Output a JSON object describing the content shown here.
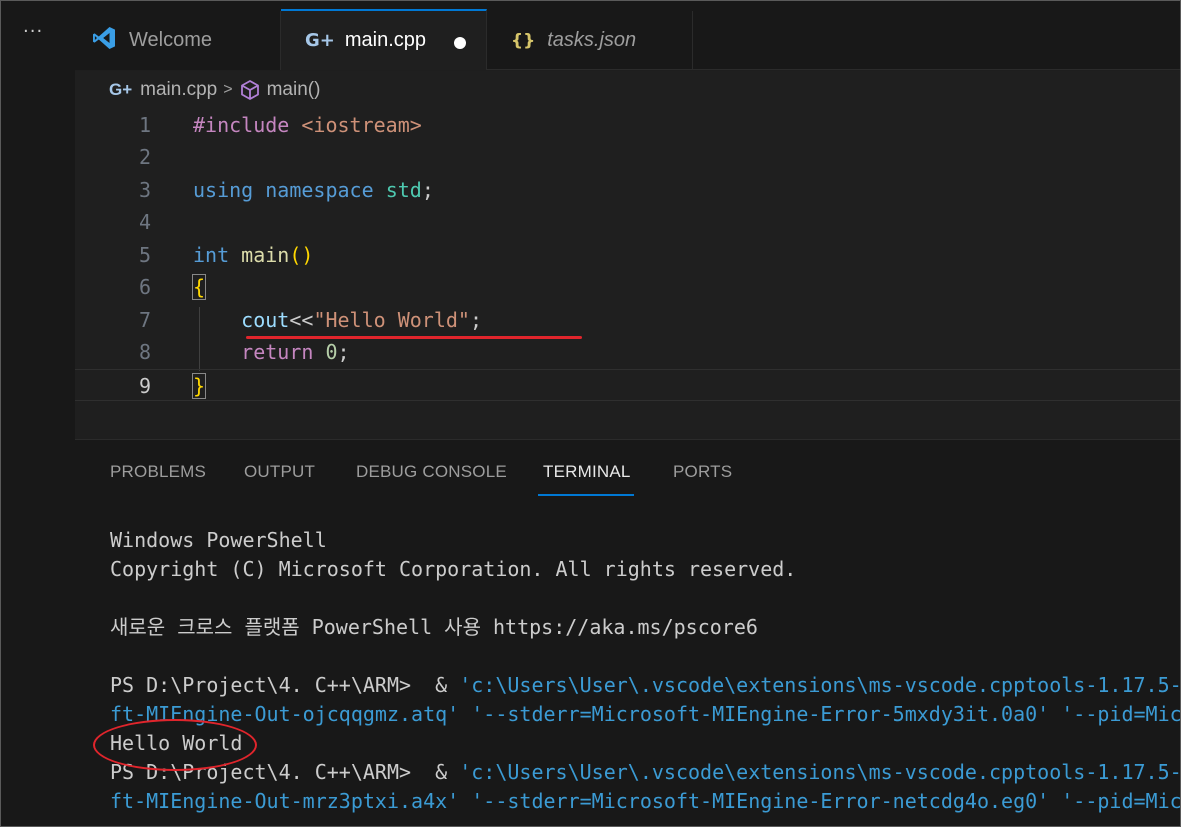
{
  "window": {
    "more_actions_label": "···"
  },
  "tabs": [
    {
      "label": "Welcome",
      "icon": "vscode-logo-icon",
      "active": false
    },
    {
      "label": "main.cpp",
      "icon": "cpp-file-icon",
      "active": true,
      "modified": true
    },
    {
      "label": "tasks.json",
      "icon": "json-file-icon",
      "active": false,
      "preview": true
    }
  ],
  "breadcrumb": {
    "file": "main.cpp",
    "symbol": "main()"
  },
  "editor": {
    "current_line": 9,
    "lines": [
      {
        "num": "1"
      },
      {
        "num": "2"
      },
      {
        "num": "3"
      },
      {
        "num": "4"
      },
      {
        "num": "5"
      },
      {
        "num": "6"
      },
      {
        "num": "7"
      },
      {
        "num": "8"
      },
      {
        "num": "9"
      }
    ],
    "tokens": {
      "l1_pre": "#include",
      "l1_inc": "<iostream>",
      "l3_using": "using",
      "l3_namespace": "namespace",
      "l3_std": "std",
      "l3_semi": ";",
      "l5_int": "int",
      "l5_main": "main",
      "l5_parens": "()",
      "l6_open": "{",
      "l7_cout": "cout",
      "l7_op": "<<",
      "l7_str": "\"Hello World\"",
      "l7_semi": ";",
      "l8_return": "return",
      "l8_zero": "0",
      "l8_semi": ";",
      "l9_close": "}"
    }
  },
  "panel": {
    "tabs": [
      "PROBLEMS",
      "OUTPUT",
      "DEBUG CONSOLE",
      "TERMINAL",
      "PORTS"
    ],
    "active_tab": "TERMINAL"
  },
  "terminal": {
    "l1": "Windows PowerShell",
    "l2": "Copyright (C) Microsoft Corporation. All rights reserved.",
    "l3": "새로운 크로스 플랫폼 PowerShell 사용 https://aka.ms/pscore6",
    "l4_prompt": "PS D:\\Project\\4. C++\\ARM>  & ",
    "l4_cmd": "'c:\\Users\\User\\.vscode\\extensions\\ms-vscode.cpptools-1.17.5-",
    "l5_a": "ft-MIEngine-Out-ojcqqgmz.atq'",
    "l5_b": " '--stderr=Microsoft-MIEngine-Error-5mxdy3it.0a0'",
    "l5_c": " '--pid=Mic",
    "l6": "Hello World",
    "l7_prompt": "PS D:\\Project\\4. C++\\ARM>  & ",
    "l7_cmd": "'c:\\Users\\User\\.vscode\\extensions\\ms-vscode.cpptools-1.17.5-",
    "l8_a": "ft-MIEngine-Out-mrz3ptxi.a4x'",
    "l8_b": " '--stderr=Microsoft-MIEngine-Error-netcdg4o.eg0'",
    "l8_c": " '--pid=Mic"
  },
  "colors": {
    "accent": "#0078d4",
    "annotation": "#e0252c"
  }
}
